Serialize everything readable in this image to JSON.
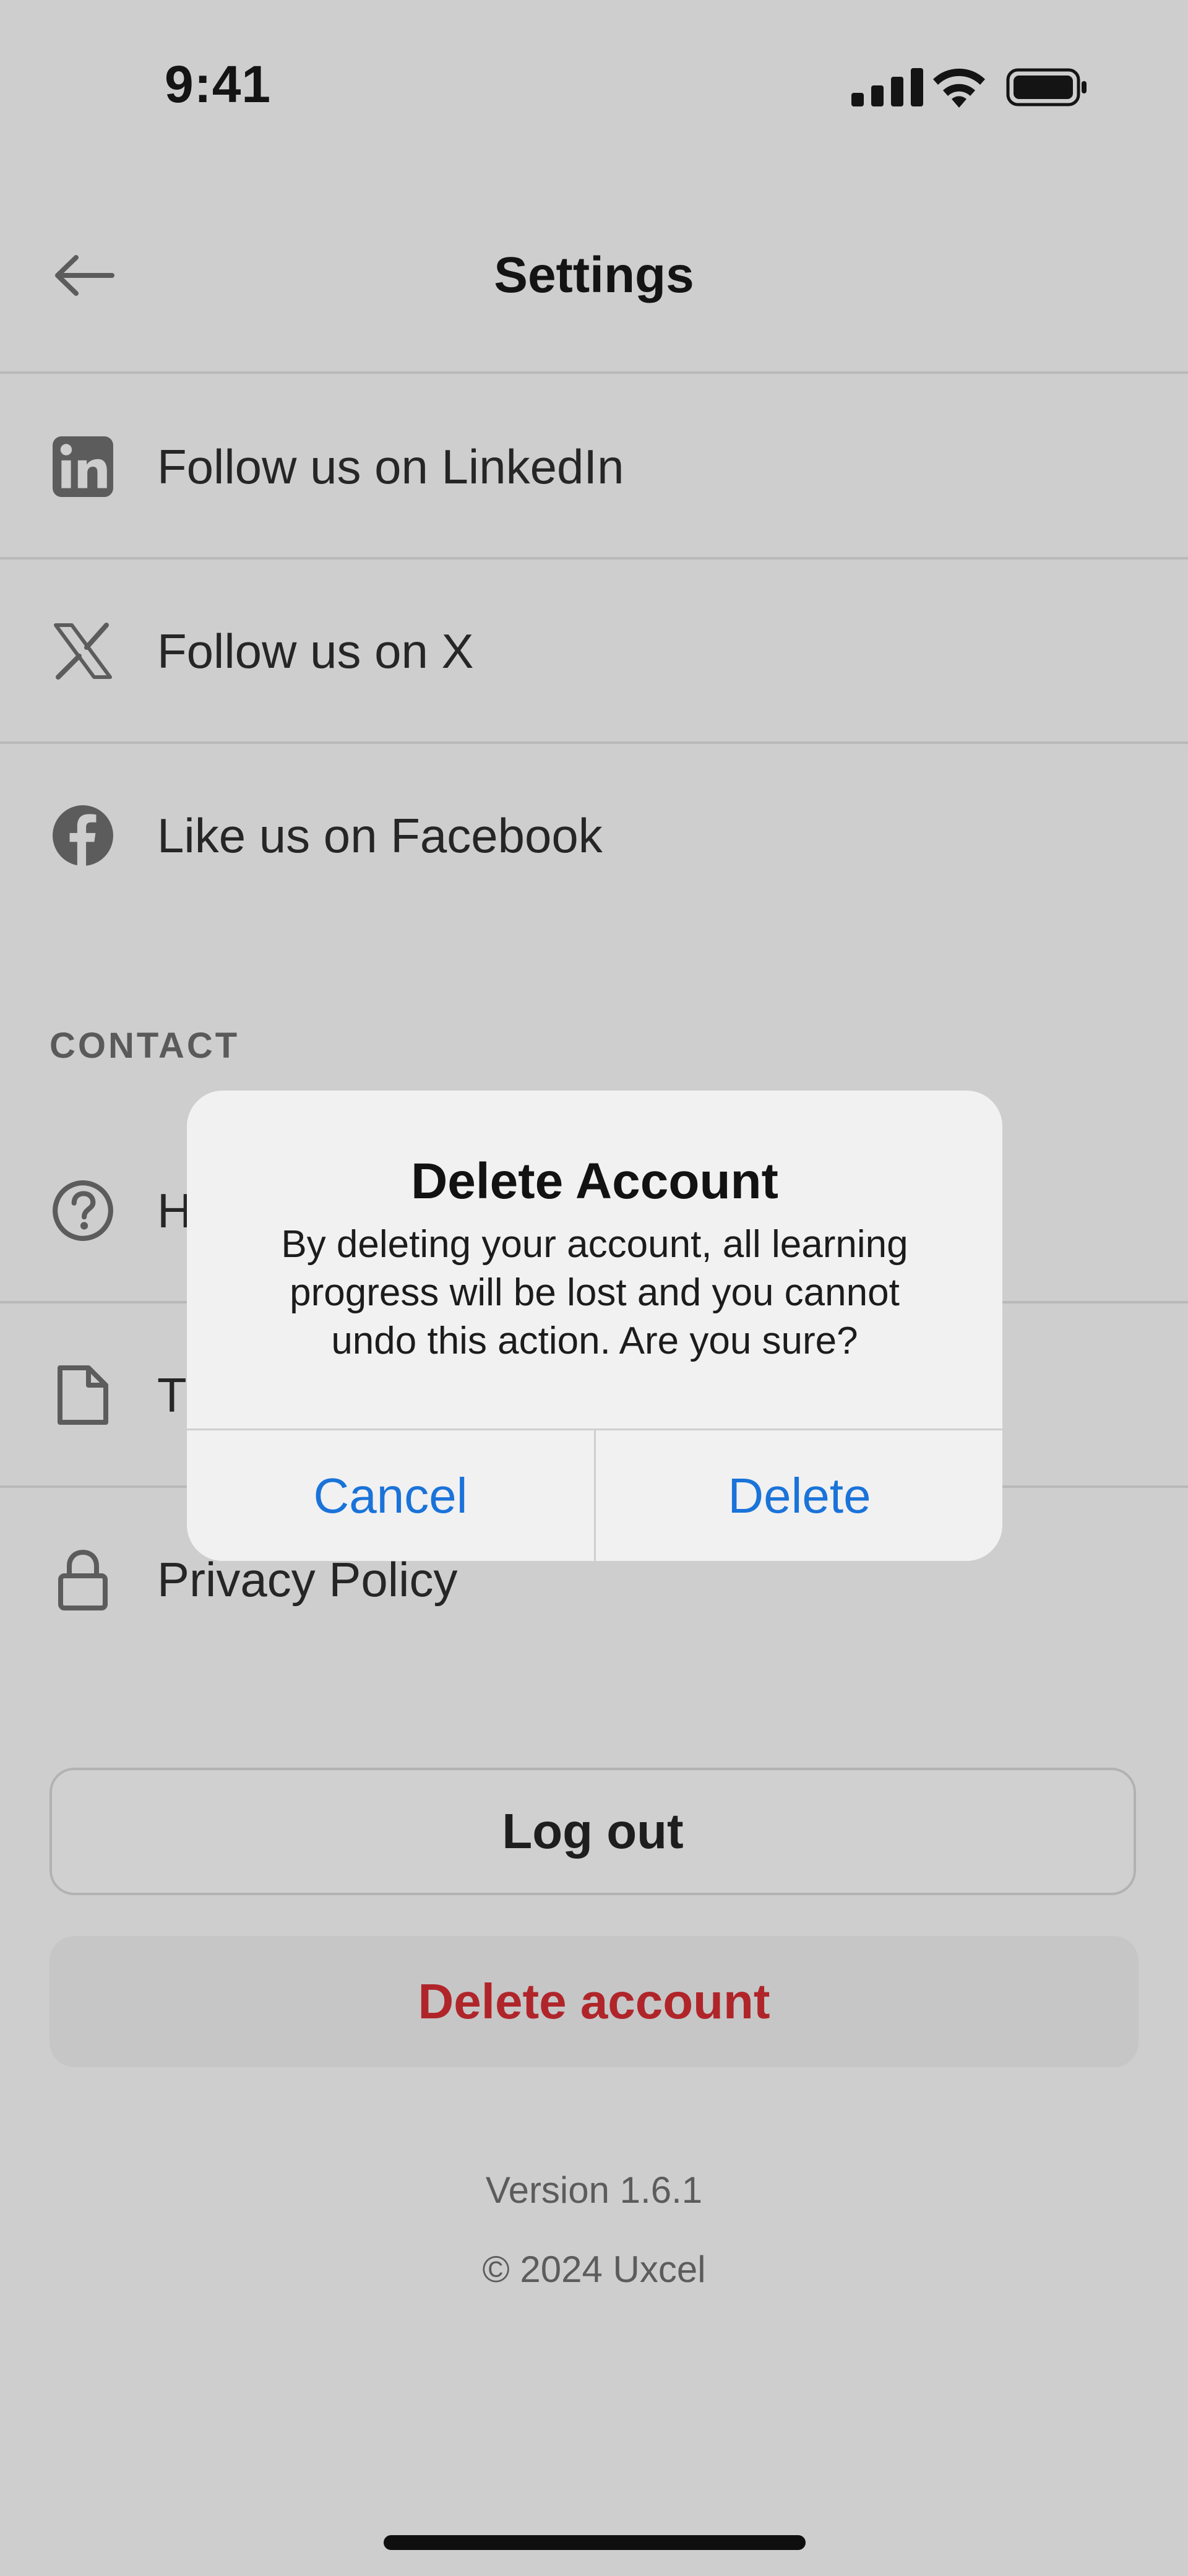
{
  "status_bar": {
    "time": "9:41"
  },
  "header": {
    "title": "Settings"
  },
  "social": [
    {
      "label": "Follow us on LinkedIn",
      "icon": "linkedin-icon"
    },
    {
      "label": "Follow us on X",
      "icon": "x-icon"
    },
    {
      "label": "Like us on Facebook",
      "icon": "facebook-icon"
    }
  ],
  "contact": {
    "section_title": "CONTACT",
    "items": [
      {
        "label": "H",
        "icon": "help-icon"
      },
      {
        "label": "T",
        "icon": "document-icon"
      },
      {
        "label": "Privacy Policy",
        "icon": "lock-icon"
      }
    ]
  },
  "actions": {
    "logout": "Log out",
    "delete_account": "Delete account"
  },
  "footer": {
    "version": "Version 1.6.1",
    "copyright": "© 2024 Uxcel"
  },
  "alert": {
    "title": "Delete Account",
    "message": "By deleting your account, all learning progress will be lost and you cannot undo this action. Are you sure?",
    "cancel": "Cancel",
    "confirm": "Delete"
  },
  "colors": {
    "backdrop": "#cecece",
    "accent_blue": "#1a73d9",
    "destructive_red": "#b0252a"
  }
}
